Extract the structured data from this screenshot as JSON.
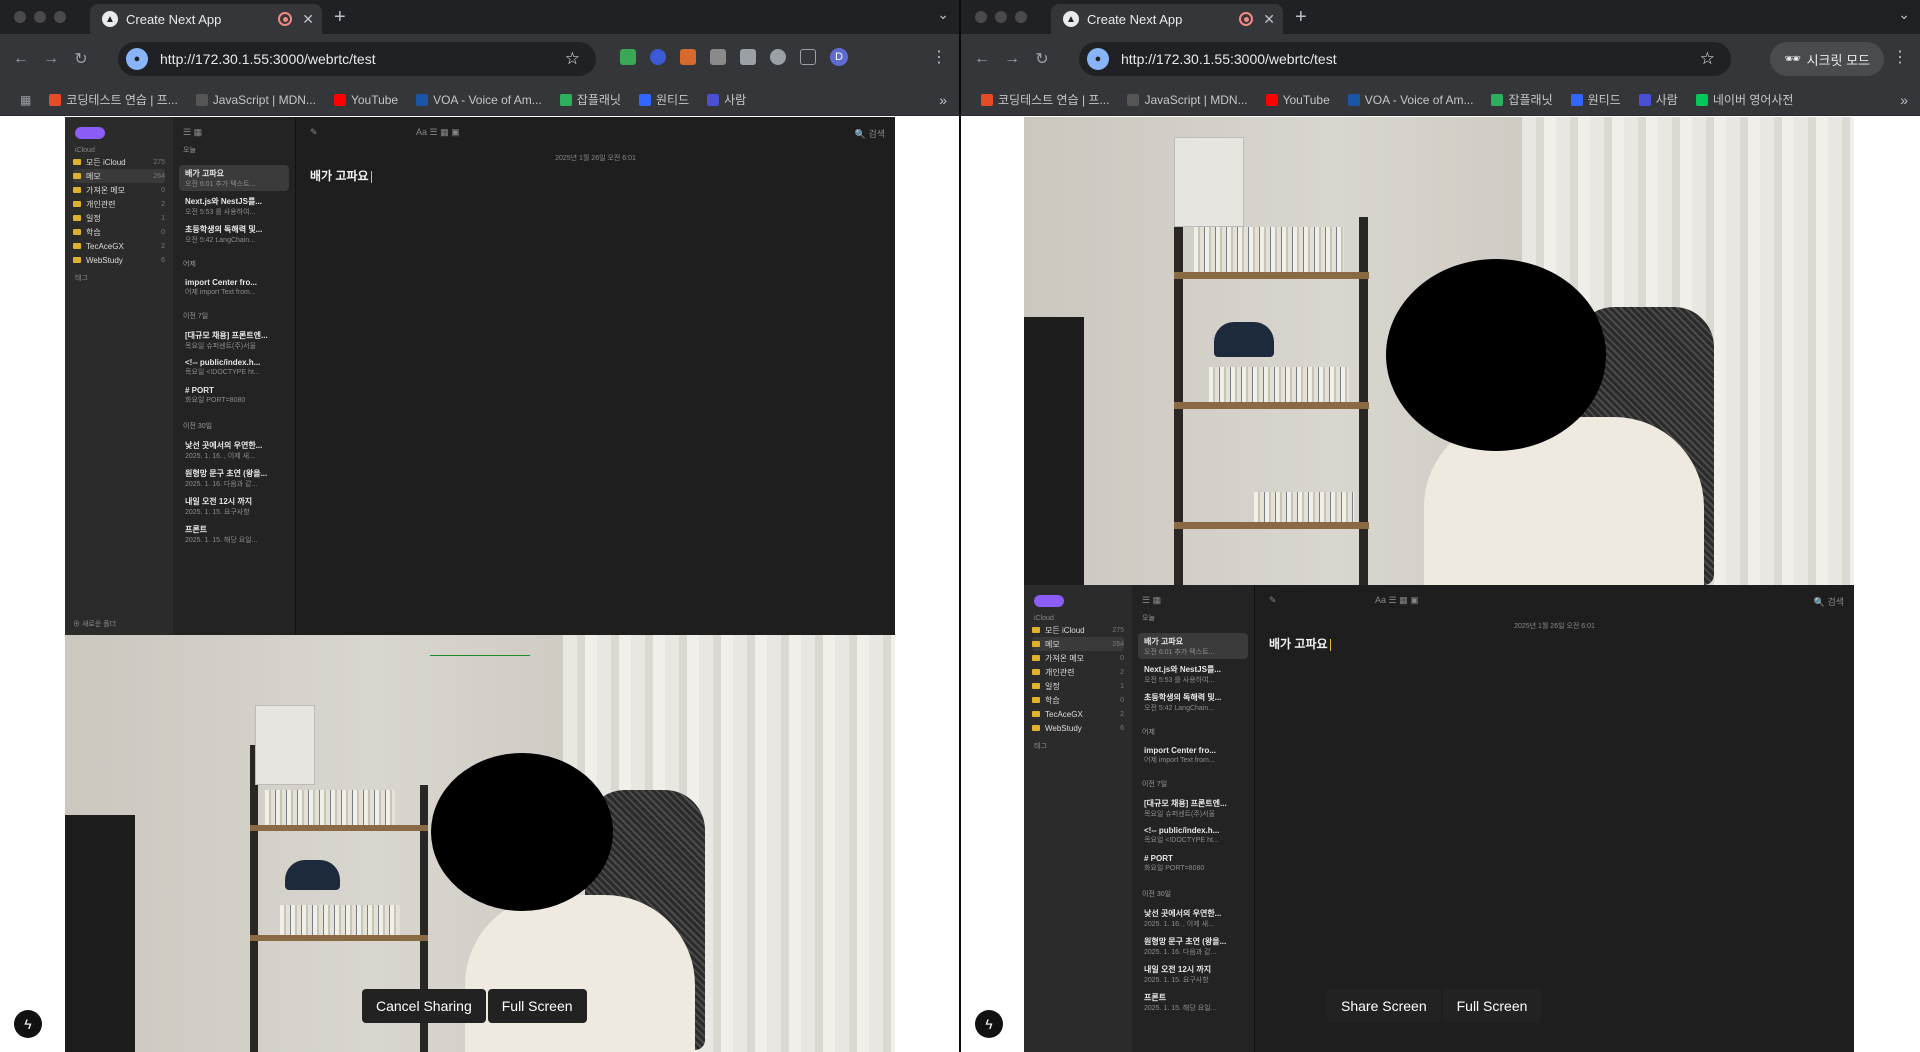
{
  "tab_title": "Create Next App",
  "url": "http://172.30.1.55:3000/webrtc/test",
  "profile_initial": "D",
  "incognito_label": "시크릿 모드",
  "bookmarks_left": [
    {
      "label": "코딩테스트 연습 | 프...",
      "color": "#e34c26"
    },
    {
      "label": "JavaScript | MDN...",
      "color": "#555"
    },
    {
      "label": "YouTube",
      "color": "#ff0000"
    },
    {
      "label": "VOA - Voice of Am...",
      "color": "#1a56a8"
    },
    {
      "label": "잡플래닛",
      "color": "#2eaf5e"
    },
    {
      "label": "원티드",
      "color": "#3366ff"
    },
    {
      "label": "사람",
      "color": "#4b4fd1"
    }
  ],
  "bookmarks_right": [
    {
      "label": "코딩테스트 연습 | 프...",
      "color": "#e34c26"
    },
    {
      "label": "JavaScript | MDN...",
      "color": "#555"
    },
    {
      "label": "YouTube",
      "color": "#ff0000"
    },
    {
      "label": "VOA - Voice of Am...",
      "color": "#1a56a8"
    },
    {
      "label": "잡플래닛",
      "color": "#2eaf5e"
    },
    {
      "label": "원티드",
      "color": "#3366ff"
    },
    {
      "label": "사람",
      "color": "#4b4fd1"
    },
    {
      "label": "네이버 영어사전",
      "color": "#03c75a"
    }
  ],
  "notes": {
    "icloud": "iCloud",
    "folders": [
      {
        "name": "모든 iCloud",
        "count": "275"
      },
      {
        "name": "메모",
        "count": "264"
      },
      {
        "name": "가져온 메모",
        "count": "0"
      },
      {
        "name": "개인관련",
        "count": "2"
      },
      {
        "name": "일정",
        "count": "1"
      },
      {
        "name": "학습",
        "count": "0"
      },
      {
        "name": "TecAceGX",
        "count": "2"
      },
      {
        "name": "WebStudy",
        "count": "6"
      }
    ],
    "tags": "태그",
    "new_folder": "새로운 폴더",
    "sections": [
      "오늘",
      "어제",
      "이전 7일",
      "이전 30일"
    ],
    "items": [
      {
        "t": "배가 고파요",
        "s": "오전 6:01  추가 텍스트..."
      },
      {
        "t": "Next.js와 NestJS를...",
        "s": "오전 5:53  를 사용하여..."
      },
      {
        "t": "초등학생의 독해력 및...",
        "s": "오전 5:42  LangChain..."
      },
      {
        "t": "import Center fro...",
        "s": "어제  import Text from..."
      },
      {
        "t": "[대규모 채용] 프론트엔...",
        "s": "목요일  슈퍼센트(주)서울"
      },
      {
        "t": "<!-- public/index.h...",
        "s": "목요일  <!DOCTYPE ht..."
      },
      {
        "t": "# PORT",
        "s": "화요일  PORT=8080"
      },
      {
        "t": "낯선 곳에서의 우연한...",
        "s": "2025. 1. 16.  , 이제 새..."
      },
      {
        "t": "원형망 문구 초연 (왕을...",
        "s": "2025. 1. 16.  다음과 같..."
      },
      {
        "t": "내일 오전 12시 까지",
        "s": "2025. 1. 15.  요구사항"
      },
      {
        "t": "프론트",
        "s": "2025. 1. 15.  해당 요일..."
      }
    ],
    "date": "2025년 1월 26일 오전 6:01",
    "title": "배가 고파요",
    "search": "검색"
  },
  "left_buttons": {
    "cancel": "Cancel Sharing",
    "full": "Full Screen"
  },
  "right_buttons": {
    "share": "Share Screen",
    "full": "Full Screen"
  }
}
